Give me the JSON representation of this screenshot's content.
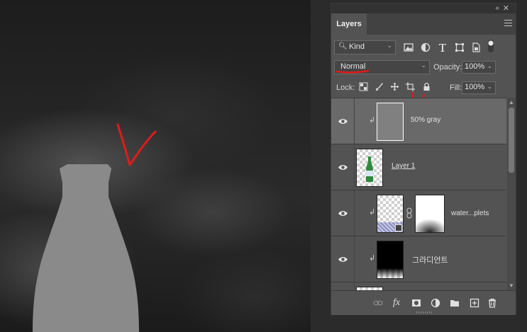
{
  "panel": {
    "collapse_glyph": "«",
    "close_glyph": "✕",
    "tab_label": "Layers",
    "menu_icon": "hamburger-menu-icon"
  },
  "filter": {
    "kind_label": "Kind",
    "icons": [
      "pixel-filter-icon",
      "adjustment-filter-icon",
      "type-filter-icon",
      "shape-filter-icon",
      "smart-object-filter-icon",
      "filter-toggle-icon"
    ]
  },
  "blend": {
    "mode": "Normal",
    "opacity_label": "Opacity:",
    "opacity_value": "100%"
  },
  "lock": {
    "label": "Lock:",
    "icons": [
      "lock-transparent-icon",
      "lock-paint-icon",
      "lock-position-icon",
      "lock-artboard-icon",
      "lock-all-icon"
    ],
    "fill_label": "Fill:",
    "fill_value": "100%"
  },
  "layers": [
    {
      "name": "50%  gray",
      "selected": true,
      "clipped": true
    },
    {
      "name": "Layer 1",
      "selected": false,
      "clipped": false
    },
    {
      "name": "water...plets",
      "selected": false,
      "clipped": true,
      "has_mask": true
    },
    {
      "name": "그라디언트",
      "selected": false,
      "clipped": true
    }
  ],
  "bottom_icons": [
    "link-layers-icon",
    "fx-icon",
    "add-mask-icon",
    "adjustment-layer-icon",
    "group-folder-icon",
    "new-layer-icon",
    "trash-icon"
  ],
  "colors": {
    "annotation_red": "#e01b1b",
    "bottle_gray": "#8a8a8a",
    "panel_bg": "#535353"
  }
}
